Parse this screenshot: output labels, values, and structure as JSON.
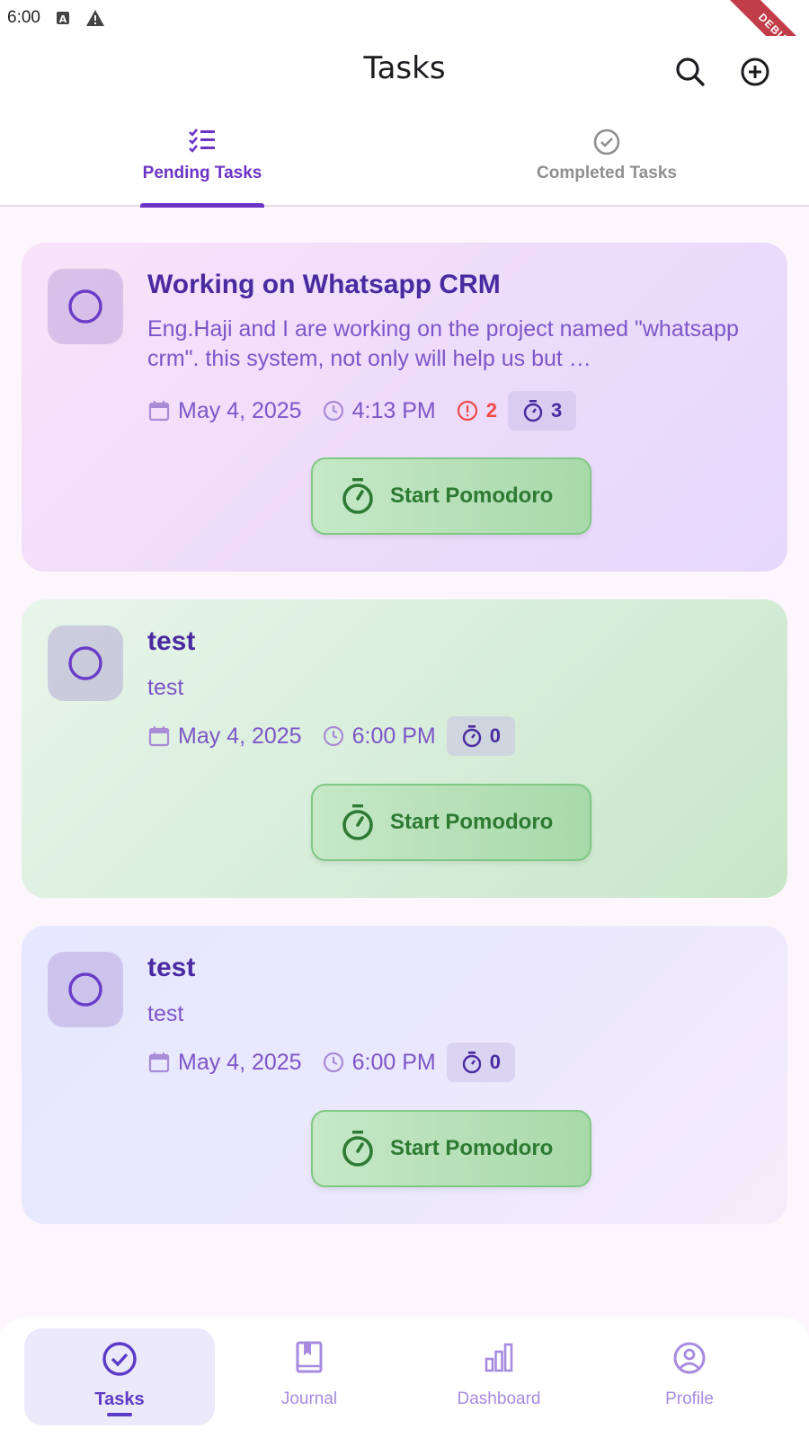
{
  "status_bar": {
    "time": "6:00",
    "icons": [
      "a-badge-icon",
      "warning-icon"
    ]
  },
  "debug_banner": "DEBUG",
  "app_bar": {
    "title": "Tasks",
    "actions": [
      "search-icon",
      "add-circle-icon"
    ]
  },
  "tabs": [
    {
      "label": "Pending Tasks",
      "icon": "checklist-icon",
      "active": true
    },
    {
      "label": "Completed Tasks",
      "icon": "check-circle-icon",
      "active": false
    }
  ],
  "tasks": [
    {
      "title": "Working on Whatsapp CRM",
      "description": "Eng.Haji and I are working on the project named \"whatsapp crm\". this system, not only will help us but …",
      "date": "May 4, 2025",
      "time": "4:13 PM",
      "priority_count": "2",
      "pomodoro_count": "3",
      "button_label": "Start Pomodoro"
    },
    {
      "title": "test",
      "description": "test",
      "date": "May 4, 2025",
      "time": "6:00 PM",
      "pomodoro_count": "0",
      "button_label": "Start Pomodoro"
    },
    {
      "title": "test",
      "description": "test",
      "date": "May 4, 2025",
      "time": "6:00 PM",
      "pomodoro_count": "0",
      "button_label": "Start Pomodoro"
    }
  ],
  "bottom_nav": [
    {
      "label": "Tasks",
      "icon": "check-circle-icon",
      "active": true
    },
    {
      "label": "Journal",
      "icon": "book-icon",
      "active": false
    },
    {
      "label": "Dashboard",
      "icon": "bar-chart-icon",
      "active": false
    },
    {
      "label": "Profile",
      "icon": "account-circle-icon",
      "active": false
    }
  ],
  "colors": {
    "primary": "#6c34c4",
    "title_text": "#4a2aa0",
    "priority": "#f04848",
    "pomodoro_green": "#2d7a33"
  }
}
